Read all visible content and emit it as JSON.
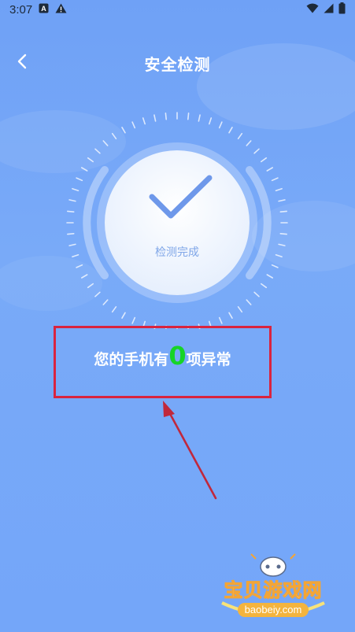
{
  "status_bar": {
    "time": "3:07",
    "notification_icons": [
      "a-box-icon",
      "warning-icon"
    ],
    "system_icons": [
      "wifi-icon",
      "signal-icon",
      "battery-icon"
    ]
  },
  "header": {
    "title": "安全检测"
  },
  "scan": {
    "status_label": "检测完成"
  },
  "result": {
    "prefix": "您的手机有",
    "count": "0",
    "suffix": "项异常"
  },
  "watermark": {
    "brand": "宝贝游戏网",
    "site": "baobeiy.com"
  },
  "colors": {
    "background": "#74a6f9",
    "highlight_box": "#d9243f",
    "count_green": "#17d427",
    "check_blue": "#6e98ea"
  }
}
